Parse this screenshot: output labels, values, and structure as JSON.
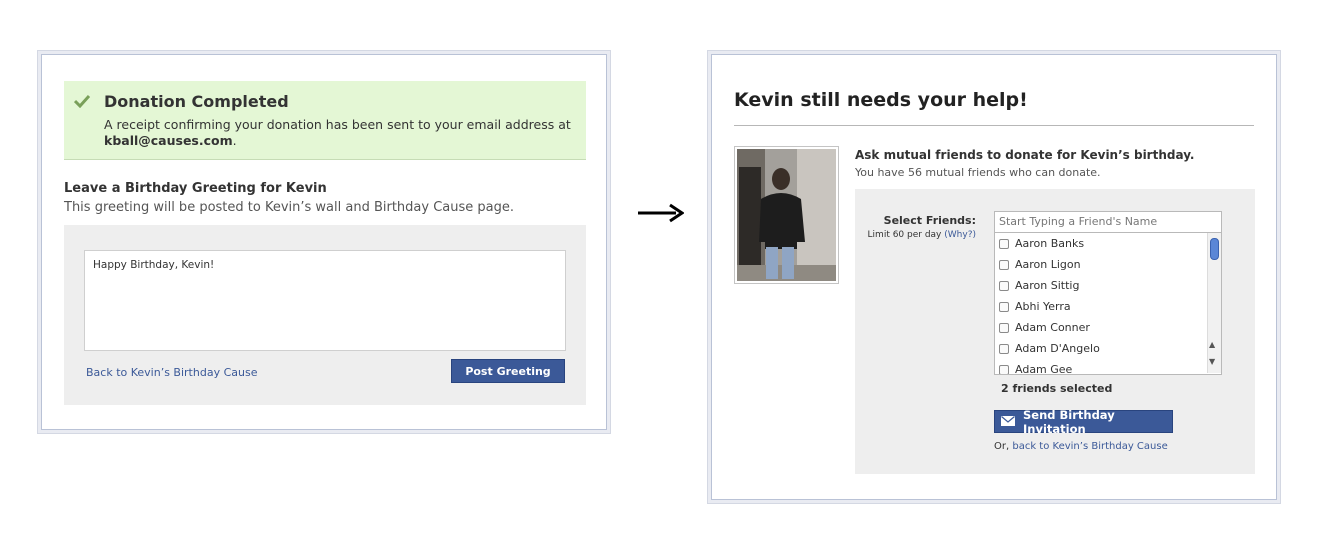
{
  "left_card": {
    "success": {
      "title": "Donation Completed",
      "text": "A receipt confirming your donation has been sent to your email address at",
      "email": "kball@causes.com",
      "email_suffix": "."
    },
    "greeting": {
      "title": "Leave a Birthday Greeting for Kevin",
      "subtitle": "This greeting will be posted to Kevin’s wall and Birthday Cause page.",
      "message": "Happy Birthday, Kevin!",
      "back_link": "Back to Kevin’s Birthday Cause",
      "post_button": "Post Greeting"
    }
  },
  "right_card": {
    "title": "Kevin still needs your help!",
    "ask_title": "Ask mutual friends to donate for Kevin’s birthday.",
    "ask_subtitle": "You have 56 mutual friends who can donate.",
    "select_label": "Select Friends:",
    "limit_text": "Limit 60 per day",
    "why_link": "(Why?)",
    "search_placeholder": "Start Typing a Friend's Name",
    "friends": [
      {
        "name": "Aaron Banks"
      },
      {
        "name": "Aaron Ligon"
      },
      {
        "name": "Aaron Sittig"
      },
      {
        "name": "Abhi Yerra"
      },
      {
        "name": "Adam Conner"
      },
      {
        "name": "Adam D'Angelo"
      },
      {
        "name": "Adam Gee"
      }
    ],
    "selected_count": "2 friends selected",
    "send_button": "Send Birthday Invitation",
    "or_prefix": "Or,",
    "back_link": "back to Kevin’s Birthday Cause"
  },
  "colors": {
    "accent": "#3b5998",
    "success_bg": "#e4f7d5",
    "panel_bg": "#eeeeee"
  },
  "icons": [
    "check-icon",
    "arrow-right-icon",
    "envelope-icon",
    "scroll-up-icon",
    "scroll-down-icon"
  ]
}
